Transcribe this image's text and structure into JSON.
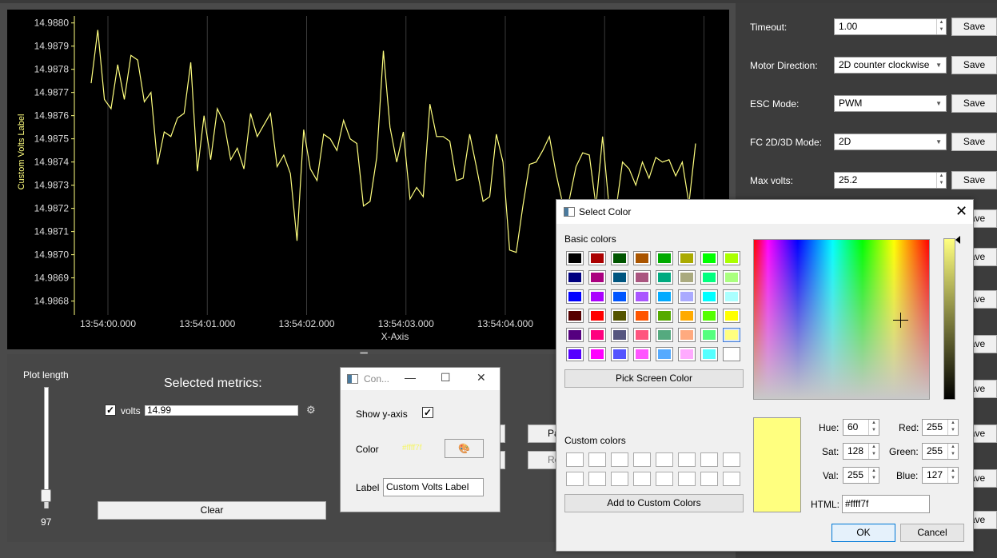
{
  "chart": {
    "y_axis_label": "Custom Volts Label",
    "x_axis_label": "X-Axis",
    "y_ticks": [
      "14.9880",
      "14.9879",
      "14.9878",
      "14.9877",
      "14.9876",
      "14.9875",
      "14.9874",
      "14.9873",
      "14.9872",
      "14.9871",
      "14.9870",
      "14.9869",
      "14.9868"
    ],
    "x_ticks": [
      "13:54:00.000",
      "13:54:01.000",
      "13:54:02.000",
      "13:54:03.000",
      "13:54:04.000"
    ],
    "line_color": "#ffff7f"
  },
  "chart_data": {
    "type": "line",
    "title": "",
    "xlabel": "X-Axis",
    "ylabel": "Custom Volts Label",
    "ylim": [
      14.98674,
      14.98803
    ],
    "grid": "vertical",
    "series": [
      {
        "color": "#ffff7f",
        "values": [
          14.98774,
          14.98797,
          14.98767,
          14.98763,
          14.98782,
          14.98767,
          14.98786,
          14.98784,
          14.98766,
          14.9877,
          14.98739,
          14.98753,
          14.98751,
          14.98759,
          14.98761,
          14.98783,
          14.98736,
          14.9876,
          14.98741,
          14.98763,
          14.98757,
          14.98741,
          14.98746,
          14.98737,
          14.98761,
          14.98751,
          14.98756,
          14.98761,
          14.98738,
          14.98743,
          14.98735,
          14.98706,
          14.98754,
          14.98737,
          14.98732,
          14.98752,
          14.9875,
          14.98745,
          14.98758,
          14.9875,
          14.98748,
          14.98721,
          14.98723,
          14.98742,
          14.98788,
          14.98755,
          14.9874,
          14.98753,
          14.98724,
          14.98729,
          14.98725,
          14.98765,
          14.98751,
          14.98751,
          14.98749,
          14.98732,
          14.98733,
          14.98752,
          14.98738,
          14.98723,
          14.98725,
          14.98752,
          14.9874,
          14.98702,
          14.98701,
          14.98721,
          14.98739,
          14.9874,
          14.98745,
          14.98751,
          14.98735,
          14.98722,
          14.98724,
          14.98738,
          14.98744,
          14.98743,
          14.98721,
          14.98751,
          14.9872,
          14.98719,
          14.9874,
          14.98737,
          14.9873,
          14.9874,
          14.98733,
          14.98742,
          14.9874,
          14.98741,
          14.98734,
          14.9874,
          14.98722,
          14.98748
        ]
      }
    ]
  },
  "bottom": {
    "plot_length_label": "Plot length",
    "plot_length_value": "97",
    "plot_length_fraction": 0.05,
    "selected_metrics_title": "Selected metrics:",
    "metric": {
      "checked": "✓",
      "label": "volts",
      "value": "14.99"
    },
    "clear_label": "Clear",
    "partial_btn_1": "Pa",
    "partial_btn_2": "Re"
  },
  "settings": [
    {
      "label": "Timeout:",
      "value": "1.00",
      "kind": "spin",
      "save": "Save"
    },
    {
      "label": "Motor Direction:",
      "value": "2D counter clockwise",
      "kind": "combo",
      "save": "Save"
    },
    {
      "label": "ESC Mode:",
      "value": "PWM",
      "kind": "combo",
      "save": "Save"
    },
    {
      "label": "FC 2D/3D Mode:",
      "value": "2D",
      "kind": "combo",
      "save": "Save"
    },
    {
      "label": "Max volts:",
      "value": "25.2",
      "kind": "spin",
      "save": "Save"
    }
  ],
  "extra_save_label": "Save",
  "config_dialog": {
    "title": "Con...",
    "show_y_axis_label": "Show y-axis",
    "show_y_axis_checked": "✓",
    "color_label": "Color",
    "color_swatch_text": "#ffff7f",
    "palette_icon": "🎨",
    "label_label": "Label",
    "label_value": "Custom Volts Label"
  },
  "color_dialog": {
    "title": "Select Color",
    "basic_colors_label": "Basic colors",
    "basic_colors": [
      [
        "#000000",
        "#aa0000",
        "#005500",
        "#aa5500",
        "#00aa00",
        "#aaaa00",
        "#00ff00",
        "#aaff00"
      ],
      [
        "#00007f",
        "#aa007f",
        "#00557f",
        "#aa557f",
        "#00aa7f",
        "#aaaa7f",
        "#00ff7f",
        "#aaff7f"
      ],
      [
        "#0000ff",
        "#aa00ff",
        "#0055ff",
        "#aa55ff",
        "#00aaff",
        "#aaaaff",
        "#00ffff",
        "#aaffff"
      ],
      [
        "#550000",
        "#ff0000",
        "#555500",
        "#ff5500",
        "#55aa00",
        "#ffaa00",
        "#55ff00",
        "#ffff00"
      ],
      [
        "#55007f",
        "#ff007f",
        "#55557f",
        "#ff557f",
        "#55aa7f",
        "#ffaa7f",
        "#55ff7f",
        "#ffff7f"
      ],
      [
        "#5500ff",
        "#ff00ff",
        "#5555ff",
        "#ff55ff",
        "#55aaff",
        "#ffaaff",
        "#55ffff",
        "#ffffff"
      ]
    ],
    "pick_screen_color": "Pick Screen Color",
    "custom_colors_label": "Custom colors",
    "add_to_custom": "Add to Custom Colors",
    "hue_label": "Hue:",
    "hue": "60",
    "sat_label": "Sat:",
    "sat": "128",
    "val_label": "Val:",
    "val": "255",
    "red_label": "Red:",
    "red": "255",
    "green_label": "Green:",
    "green": "255",
    "blue_label": "Blue:",
    "blue": "127",
    "html_label": "HTML:",
    "html_value": "#ffff7f",
    "ok": "OK",
    "cancel": "Cancel",
    "current_color": "#ffff7f"
  }
}
